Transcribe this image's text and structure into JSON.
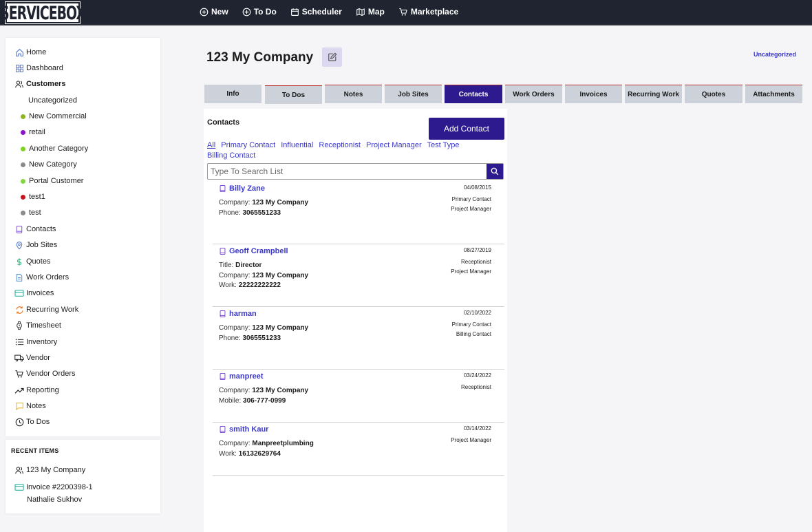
{
  "app": {
    "logo_text": "SERVICEBOX"
  },
  "topnav": [
    {
      "label": "New",
      "icon": "plus-circle-icon"
    },
    {
      "label": "To Do",
      "icon": "plus-circle-icon"
    },
    {
      "label": "Scheduler",
      "icon": "calendar-icon"
    },
    {
      "label": "Map",
      "icon": "map-icon"
    },
    {
      "label": "Marketplace",
      "icon": "cart-icon"
    }
  ],
  "sidebar": {
    "items": [
      {
        "label": "Home",
        "icon": "home-icon"
      },
      {
        "label": "Dashboard",
        "icon": "dashboard-icon"
      },
      {
        "label": "Customers",
        "icon": "users-icon"
      },
      {
        "label": "Contacts",
        "icon": "book-icon"
      },
      {
        "label": "Job Sites",
        "icon": "location-pin-icon"
      },
      {
        "label": "Quotes",
        "icon": "dollar-icon"
      },
      {
        "label": "Work Orders",
        "icon": "document-icon"
      },
      {
        "label": "Invoices",
        "icon": "credit-card-icon"
      },
      {
        "label": "Recurring Work",
        "icon": "refresh-icon"
      },
      {
        "label": "Timesheet",
        "icon": "watch-icon"
      },
      {
        "label": "Inventory",
        "icon": "list-icon"
      },
      {
        "label": "Vendor",
        "icon": "truck-icon"
      },
      {
        "label": "Vendor Orders",
        "icon": "cart-icon"
      },
      {
        "label": "Reporting",
        "icon": "trending-up-icon"
      },
      {
        "label": "Notes",
        "icon": "message-icon"
      },
      {
        "label": "To Dos",
        "icon": "clock-icon"
      }
    ],
    "categories": [
      {
        "label": "Uncategorized",
        "color": ""
      },
      {
        "label": "New Commercial",
        "color": "#8cb320"
      },
      {
        "label": "retail",
        "color": "#8a14c8"
      },
      {
        "label": "Another Category",
        "color": "#7ed321"
      },
      {
        "label": "New Category",
        "color": "#8a8a8a"
      },
      {
        "label": "Portal Customer",
        "color": "#84d640"
      },
      {
        "label": "test1",
        "color": "#c8161d"
      },
      {
        "label": "test",
        "color": "#8a8a8a"
      }
    ]
  },
  "recent": {
    "title": "RECENT ITEMS",
    "items": [
      {
        "label": "123 My Company",
        "icon": "users-icon"
      },
      {
        "label": "Invoice #2200398-1",
        "sub": "Nathalie Sukhov",
        "icon": "credit-card-icon"
      }
    ]
  },
  "header": {
    "title": "123 My Company",
    "category": "Uncategorized"
  },
  "tabs": [
    {
      "label": "Info"
    },
    {
      "label": "To Dos"
    },
    {
      "label": "Notes"
    },
    {
      "label": "Job Sites"
    },
    {
      "label": "Contacts",
      "active": true
    },
    {
      "label": "Work Orders"
    },
    {
      "label": "Invoices"
    },
    {
      "label": "Recurring Work"
    },
    {
      "label": "Quotes"
    },
    {
      "label": "Attachments"
    }
  ],
  "contacts_panel": {
    "title": "Contacts",
    "add_button": "Add Contact",
    "filters": [
      "All",
      "Primary Contact",
      "Influential",
      "Receptionist",
      "Project Manager",
      "Test Type",
      "Billing Contact"
    ],
    "search_placeholder": "Type To Search List",
    "contacts": [
      {
        "name": "Billy Zane",
        "date": "04/08/2015",
        "roles": [
          "Primary Contact",
          "Project Manager"
        ],
        "fields": [
          {
            "label": "Company:",
            "value": "123 My Company"
          },
          {
            "label": "Phone:",
            "value": "3065551233"
          }
        ]
      },
      {
        "name": "Geoff Crampbell",
        "date": "08/27/2019",
        "roles": [
          "Receptionist",
          "Project Manager"
        ],
        "fields": [
          {
            "label": "Title:",
            "value": "Director"
          },
          {
            "label": "Company:",
            "value": "123 My Company"
          },
          {
            "label": "Work:",
            "value": "22222222222"
          }
        ]
      },
      {
        "name": "harman",
        "date": "02/10/2022",
        "roles": [
          "Primary Contact",
          "Billing Contact"
        ],
        "fields": [
          {
            "label": "Company:",
            "value": "123 My Company"
          },
          {
            "label": "Phone:",
            "value": "3065551233"
          }
        ]
      },
      {
        "name": "manpreet",
        "date": "03/24/2022",
        "roles": [
          "Receptionist"
        ],
        "fields": [
          {
            "label": "Company:",
            "value": "123 My Company"
          },
          {
            "label": "Mobile:",
            "value": "306-777-0999"
          }
        ]
      },
      {
        "name": "smith Kaur",
        "date": "03/14/2022",
        "roles": [
          "Project Manager"
        ],
        "fields": [
          {
            "label": "Company:",
            "value": "Manpreetplumbing"
          },
          {
            "label": "Work:",
            "value": "16132629764"
          }
        ]
      }
    ]
  }
}
